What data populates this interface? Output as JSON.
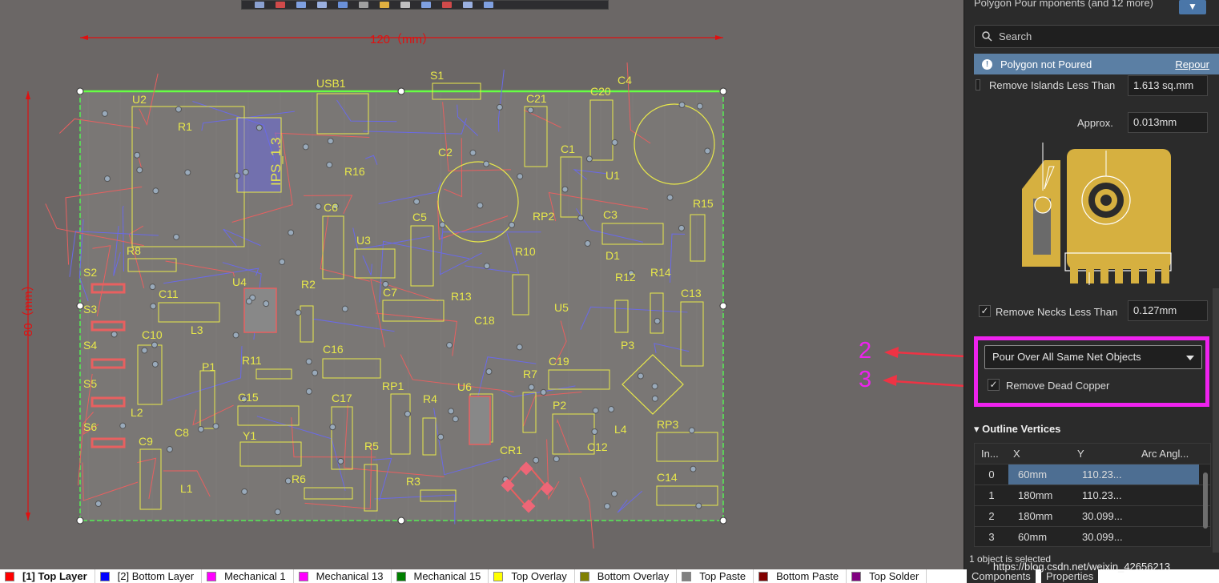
{
  "canvas": {
    "dim_width": "120（mm）",
    "dim_height": "80（mm）",
    "designators": [
      "U2",
      "USB1",
      "S1",
      "C4",
      "C21",
      "C20",
      "C1",
      "U1",
      "R1",
      "C2",
      "R16",
      "C6",
      "C5",
      "RP2",
      "C3",
      "R15",
      "U3",
      "R10",
      "D1",
      "R8",
      "R2",
      "U4",
      "S2",
      "C11",
      "S3",
      "S4",
      "C10",
      "L3",
      "R12",
      "R14",
      "C7",
      "R13",
      "C13",
      "C18",
      "U5",
      "C16",
      "R11",
      "P1",
      "C15",
      "Y1",
      "C17",
      "RP1",
      "R4",
      "U6",
      "R7",
      "C19",
      "P3",
      "S5",
      "L2",
      "C9",
      "S6",
      "C8",
      "L1",
      "R6",
      "R5",
      "R3",
      "CR1",
      "P2",
      "C12",
      "L4",
      "RP3",
      "C14"
    ],
    "ips_label": "IPS_1.3"
  },
  "annotations": {
    "two": "2",
    "three": "3"
  },
  "panel": {
    "header": "Polygon Pour   mponents (and 12 more)",
    "filter_icon": "funnel-icon",
    "search_placeholder": "Search",
    "banner": {
      "text": "Polygon not Poured",
      "link": "Repour"
    },
    "remove_islands": {
      "label": "Remove Islands Less Than",
      "value": "1.613 sq.mm"
    },
    "approx": {
      "label": "Approx.",
      "value": "0.013mm"
    },
    "remove_necks": {
      "label": "Remove Necks Less Than",
      "value": "0.127mm",
      "checked": true
    },
    "pour_over": {
      "value": "Pour Over All Same Net Objects"
    },
    "remove_dead_copper": {
      "label": "Remove Dead Copper",
      "checked": true
    },
    "outline": {
      "title": "Outline Vertices",
      "columns": [
        "In...",
        "X",
        "Y",
        "Arc Angl..."
      ],
      "rows": [
        {
          "index": "0",
          "x": "60mm",
          "y": "110.23...",
          "arc": ""
        },
        {
          "index": "1",
          "x": "180mm",
          "y": "110.23...",
          "arc": ""
        },
        {
          "index": "2",
          "x": "180mm",
          "y": "30.099...",
          "arc": ""
        },
        {
          "index": "3",
          "x": "60mm",
          "y": "30.099...",
          "arc": ""
        }
      ]
    },
    "status": "1 object is selected",
    "tabs": [
      "Components",
      "Properties"
    ]
  },
  "layers": [
    {
      "label": "[1] Top Layer",
      "color": "#ff0000"
    },
    {
      "label": "[2] Bottom Layer",
      "color": "#0000ff"
    },
    {
      "label": "Mechanical 1",
      "color": "#ff00ff"
    },
    {
      "label": "Mechanical 13",
      "color": "#ff00ff"
    },
    {
      "label": "Mechanical 15",
      "color": "#008000"
    },
    {
      "label": "Top Overlay",
      "color": "#ffff00"
    },
    {
      "label": "Bottom Overlay",
      "color": "#808000"
    },
    {
      "label": "Top Paste",
      "color": "#808080"
    },
    {
      "label": "Bottom Paste",
      "color": "#800000"
    },
    {
      "label": "Top Solder",
      "color": "#800080"
    }
  ],
  "watermark": "https://blog.csdn.net/weixin_42656213",
  "colors": {
    "accent": "#ee22ee",
    "overlay": "#e8e84a",
    "top_copper": "#e86060",
    "bottom_copper": "#6a6ae8",
    "selection": "#4d6e92"
  }
}
